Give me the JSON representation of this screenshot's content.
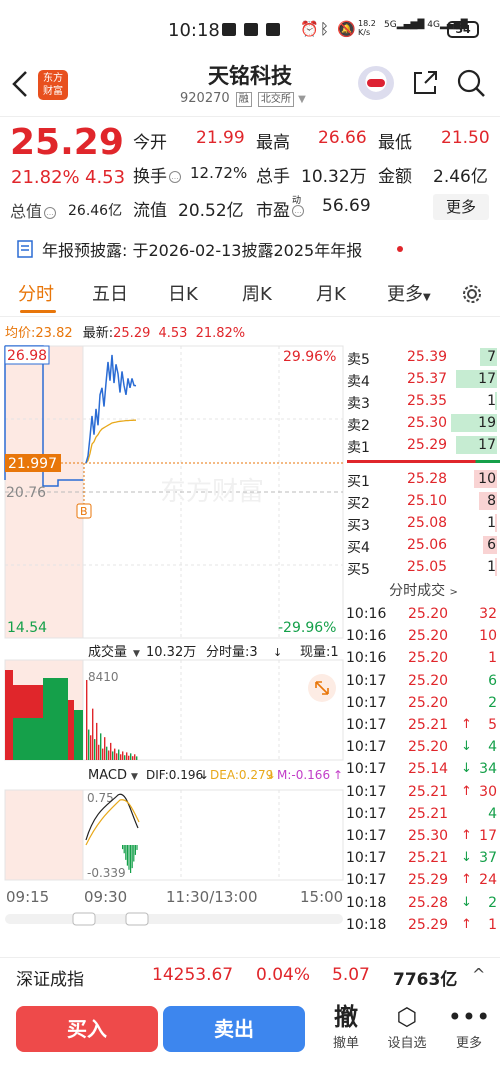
{
  "status_bar": {
    "time": "10:18",
    "net_speed": "18.2",
    "net_unit": "K/s",
    "battery": "54"
  },
  "header": {
    "logo_line1": "东方",
    "logo_line2": "财富",
    "stock_name": "天铭科技",
    "stock_code": "920270",
    "tag_margin": "融",
    "tag_exchange": "北交所"
  },
  "quote": {
    "price": "25.29",
    "pct": "21.82%",
    "chg": "4.53",
    "open_label": "今开",
    "open": "21.99",
    "high_label": "最高",
    "high": "26.66",
    "low_label": "最低",
    "low": "21.50",
    "turnover_label": "换手",
    "turnover": "12.72%",
    "volume_label": "总手",
    "volume": "10.32万",
    "amount_label": "金额",
    "amount": "2.46亿",
    "mktcap_label": "总值",
    "mktcap": "26.46亿",
    "float_label": "流值",
    "float": "20.52亿",
    "pe_label": "市盈",
    "pe_sup": "动",
    "pe": "56.69",
    "more": "更多"
  },
  "notice": {
    "label": "年报预披露:",
    "text": "于2026-02-13披露2025年年报"
  },
  "tabs": [
    "分时",
    "五日",
    "日K",
    "周K",
    "月K",
    "更多"
  ],
  "chart_header": {
    "avg_label": "均价:",
    "avg": "23.82",
    "latest_label": "最新:",
    "latest": "25.29",
    "chg": "4.53",
    "pct": "21.82%"
  },
  "chart_labels": {
    "price_top": "26.98",
    "price_mid": "21.997",
    "price_low_mark": "20.76",
    "price_bottom": "14.54",
    "pct_top": "29.96%",
    "pct_bottom": "-29.96%",
    "b_marker": "B",
    "watermark": "东方财富",
    "vol_label": "成交量",
    "vol_total": "10.32万",
    "vol_period": "分时量:3",
    "vol_now": "现量:1",
    "vol_max": "8410",
    "macd_label": "MACD",
    "dif": "DIF:0.196",
    "dea": "DEA:0.279",
    "m": "M:-0.166",
    "macd_top": "0.75",
    "macd_bottom": "-0.339",
    "time_start": "09:15",
    "time_open": "09:30",
    "time_mid": "11:30/13:00",
    "time_end": "15:00"
  },
  "chart_data": {
    "type": "line",
    "x": [
      "09:30",
      "09:31",
      "09:32",
      "09:33",
      "09:34",
      "09:35",
      "09:36",
      "09:37",
      "09:38",
      "09:39",
      "09:40",
      "09:41",
      "09:42",
      "09:43",
      "09:44",
      "09:45",
      "09:46",
      "09:47",
      "09:48",
      "09:49",
      "09:50",
      "09:51",
      "09:52",
      "09:53",
      "09:54",
      "09:55"
    ],
    "series": [
      {
        "name": "最新",
        "values": [
          21.99,
          22.3,
          23.1,
          24.0,
          23.2,
          24.3,
          23.6,
          24.9,
          25.2,
          24.4,
          25.4,
          26.3,
          25.5,
          26.6,
          25.4,
          26.2,
          25.8,
          25.0,
          25.9,
          25.3,
          24.9,
          25.6,
          25.2,
          25.6,
          25.3,
          25.29
        ]
      },
      {
        "name": "均价",
        "values": [
          21.99,
          22.1,
          22.4,
          22.8,
          22.9,
          23.1,
          23.2,
          23.35,
          23.45,
          23.5,
          23.55,
          23.6,
          23.65,
          23.7,
          23.72,
          23.74,
          23.76,
          23.77,
          23.78,
          23.79,
          23.8,
          23.8,
          23.81,
          23.81,
          23.82,
          23.82
        ]
      }
    ],
    "ylim": [
      14.54,
      26.98
    ],
    "prev_close": 20.76,
    "volumes": [
      8410,
      3200,
      2600,
      5400,
      2200,
      3900,
      1600,
      2800,
      1200,
      2400,
      1400,
      1000,
      1800,
      900,
      1200,
      700,
      1100,
      600,
      900,
      500,
      800,
      450,
      700,
      400,
      600,
      380
    ],
    "macd_bars": [
      -0.05,
      -0.1,
      -0.18,
      -0.25,
      -0.3,
      -0.339,
      -0.28,
      -0.2,
      -0.12,
      -0.06
    ]
  },
  "order_book": {
    "asks": [
      {
        "label": "卖5",
        "price": "25.39",
        "vol": "7",
        "ratio": 0.37
      },
      {
        "label": "卖4",
        "price": "25.37",
        "vol": "17",
        "ratio": 0.9
      },
      {
        "label": "卖3",
        "price": "25.35",
        "vol": "1",
        "ratio": 0.05
      },
      {
        "label": "卖2",
        "price": "25.30",
        "vol": "19",
        "ratio": 1.0
      },
      {
        "label": "卖1",
        "price": "25.29",
        "vol": "17",
        "ratio": 0.9
      }
    ],
    "bids": [
      {
        "label": "买1",
        "price": "25.28",
        "vol": "10",
        "ratio": 0.5
      },
      {
        "label": "买2",
        "price": "25.10",
        "vol": "8",
        "ratio": 0.4
      },
      {
        "label": "买3",
        "price": "25.08",
        "vol": "1",
        "ratio": 0.05
      },
      {
        "label": "买4",
        "price": "25.06",
        "vol": "6",
        "ratio": 0.3
      },
      {
        "label": "买5",
        "price": "25.05",
        "vol": "1",
        "ratio": 0.05
      }
    ]
  },
  "ticks_title": "分时成交",
  "ticks": [
    {
      "time": "10:16",
      "price": "25.20",
      "arrow": "",
      "vol": "32",
      "color": "red"
    },
    {
      "time": "10:16",
      "price": "25.20",
      "arrow": "",
      "vol": "10",
      "color": "red"
    },
    {
      "time": "10:16",
      "price": "25.20",
      "arrow": "",
      "vol": "1",
      "color": "red"
    },
    {
      "time": "10:17",
      "price": "25.20",
      "arrow": "",
      "vol": "6",
      "color": "green"
    },
    {
      "time": "10:17",
      "price": "25.20",
      "arrow": "",
      "vol": "2",
      "color": "green"
    },
    {
      "time": "10:17",
      "price": "25.21",
      "arrow": "↑",
      "vol": "5",
      "color": "red"
    },
    {
      "time": "10:17",
      "price": "25.20",
      "arrow": "↓",
      "vol": "4",
      "color": "green"
    },
    {
      "time": "10:17",
      "price": "25.14",
      "arrow": "↓",
      "vol": "34",
      "color": "green"
    },
    {
      "time": "10:17",
      "price": "25.21",
      "arrow": "↑",
      "vol": "30",
      "color": "red"
    },
    {
      "time": "10:17",
      "price": "25.21",
      "arrow": "",
      "vol": "4",
      "color": "green"
    },
    {
      "time": "10:17",
      "price": "25.30",
      "arrow": "↑",
      "vol": "17",
      "color": "red"
    },
    {
      "time": "10:17",
      "price": "25.21",
      "arrow": "↓",
      "vol": "37",
      "color": "green"
    },
    {
      "time": "10:17",
      "price": "25.29",
      "arrow": "↑",
      "vol": "24",
      "color": "red"
    },
    {
      "time": "10:18",
      "price": "25.28",
      "arrow": "↓",
      "vol": "2",
      "color": "green"
    },
    {
      "time": "10:18",
      "price": "25.29",
      "arrow": "↑",
      "vol": "1",
      "color": "red"
    }
  ],
  "index_bar": {
    "name": "深证成指",
    "price": "14253.67",
    "pct": "0.04%",
    "chg": "5.07",
    "amount": "7763亿",
    "caret": "^"
  },
  "actions": {
    "buy": "买入",
    "sell": "卖出",
    "cancel_icon": "撤",
    "cancel": "撤单",
    "watch": "设自选",
    "more": "更多"
  }
}
